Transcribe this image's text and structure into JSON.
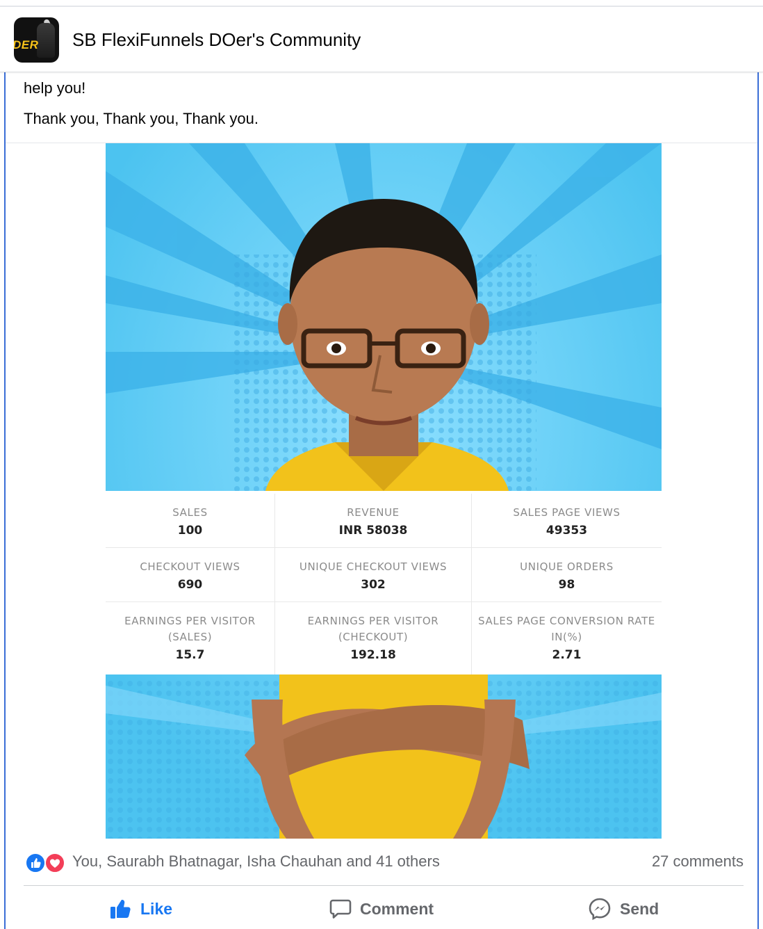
{
  "group": {
    "name": "SB FlexiFunnels DOer's Community",
    "avatar_text": "DER"
  },
  "post": {
    "cut_line_end": "help you!",
    "thanks": "Thank you, Thank you, Thank you."
  },
  "stats": [
    {
      "label": "SALES",
      "value": "100",
      "circled": true
    },
    {
      "label": "REVENUE",
      "value": "INR 58038",
      "circled": true
    },
    {
      "label": "SALES PAGE VIEWS",
      "value": "49353",
      "circled": false
    },
    {
      "label": "CHECKOUT VIEWS",
      "value": "690",
      "circled": false
    },
    {
      "label": "UNIQUE CHECKOUT VIEWS",
      "value": "302",
      "circled": false
    },
    {
      "label": "UNIQUE ORDERS",
      "value": "98",
      "circled": false
    },
    {
      "label": "EARNINGS PER VISITOR",
      "label2": "(SALES)",
      "value": "15.7",
      "circled": false
    },
    {
      "label": "EARNINGS PER VISITOR",
      "label2": "(CHECKOUT)",
      "value": "192.18",
      "circled": false
    },
    {
      "label": "SALES PAGE CONVERSION RATE",
      "label2": "IN(%)",
      "value": "2.71",
      "circled": false
    }
  ],
  "reactions": {
    "icons": [
      "like-icon",
      "love-icon"
    ],
    "reactors": "You, Saurabh Bhatnagar, Isha Chauhan and 41 others",
    "comments": "27 comments"
  },
  "actions": {
    "like": "Like",
    "comment": "Comment",
    "send": "Send"
  },
  "colors": {
    "accent": "#1877f2",
    "love": "#f33e58",
    "image_bg": "#4cc3f0",
    "shirt": "#f2c21b",
    "circle": "#d62b2b"
  }
}
